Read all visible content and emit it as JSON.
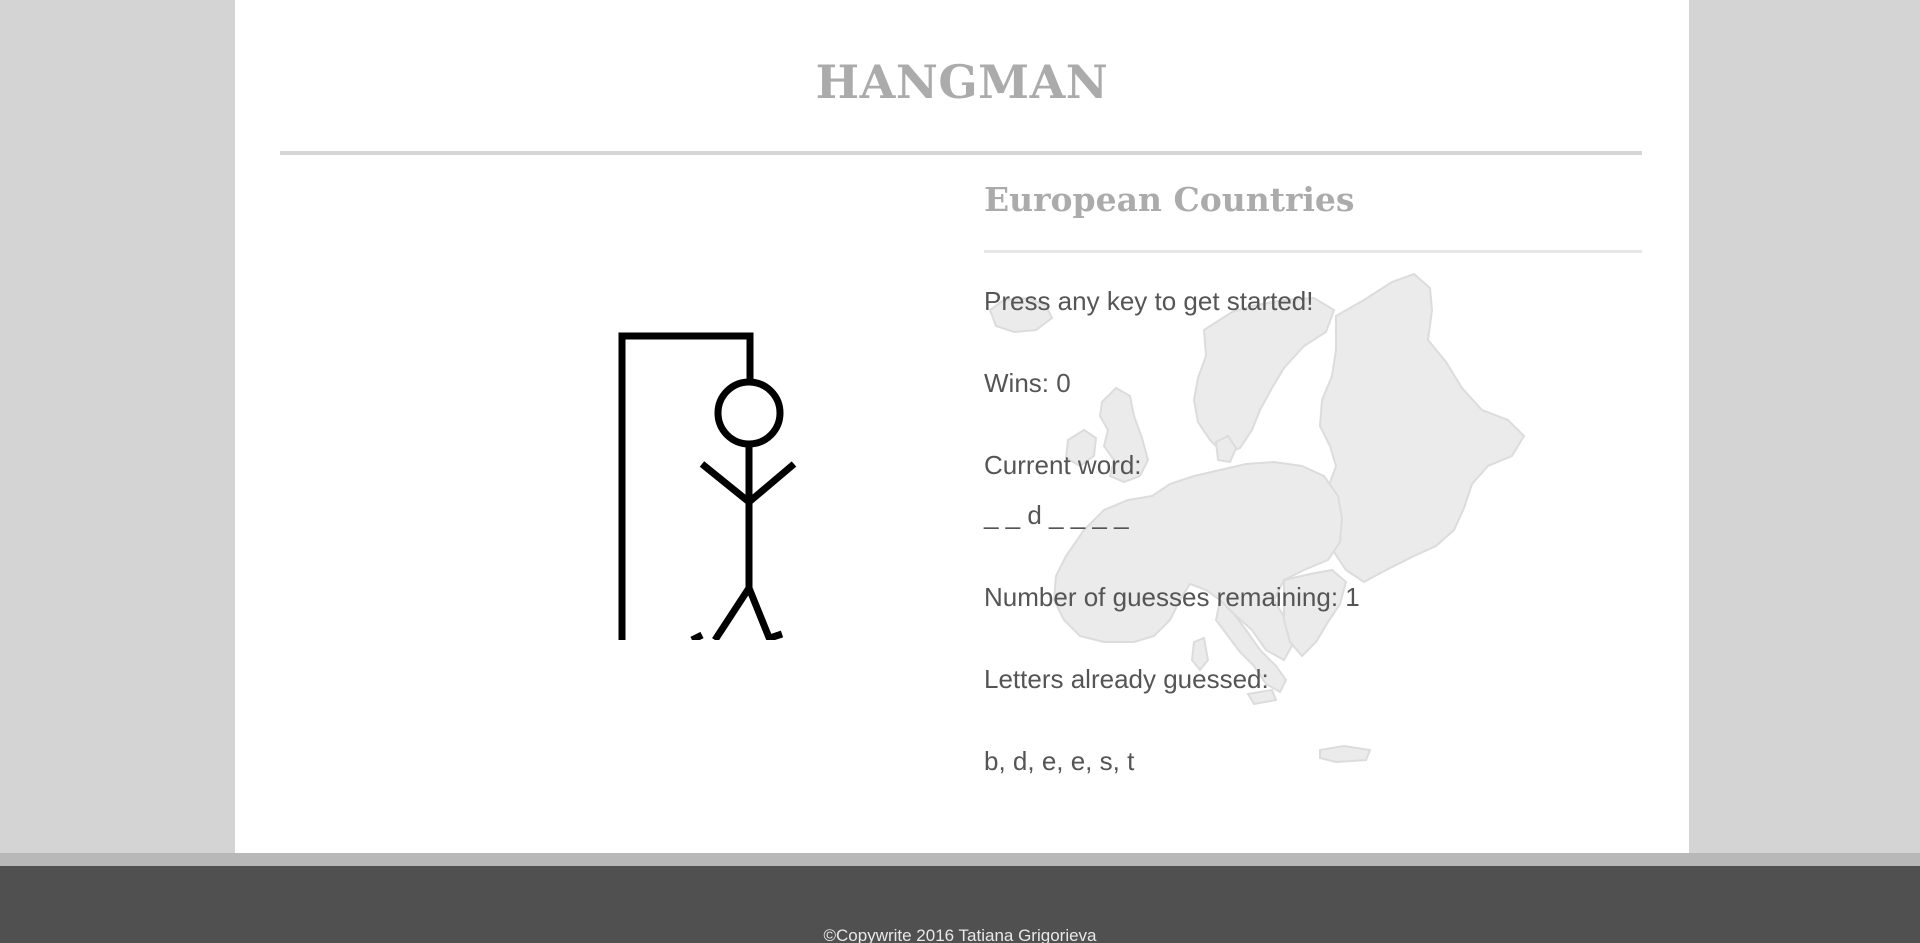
{
  "header": {
    "title": "HANGMAN"
  },
  "game": {
    "category": "European Countries",
    "prompt": "Press any key to get started!",
    "wins": "Wins: 0",
    "current_word_label": "Current word:",
    "current_word": "_ _ d _ _ _ _",
    "guesses_remaining": "Number of guesses remaining: 1",
    "letters_guessed_label": "Letters already guessed:",
    "letters_guessed": "b, d, e, e, s, t"
  },
  "footer": {
    "copyright": "©Copywrite 2016 Tatiana Grigorieva"
  },
  "colors": {
    "background": "#d4d4d4",
    "panel": "#ffffff",
    "title": "#ababab",
    "text": "#555555",
    "footer": "#505050",
    "map_fill": "#ebebeb"
  },
  "icons": {
    "hangman": "hangman-figure-icon",
    "map": "europe-map-icon"
  }
}
